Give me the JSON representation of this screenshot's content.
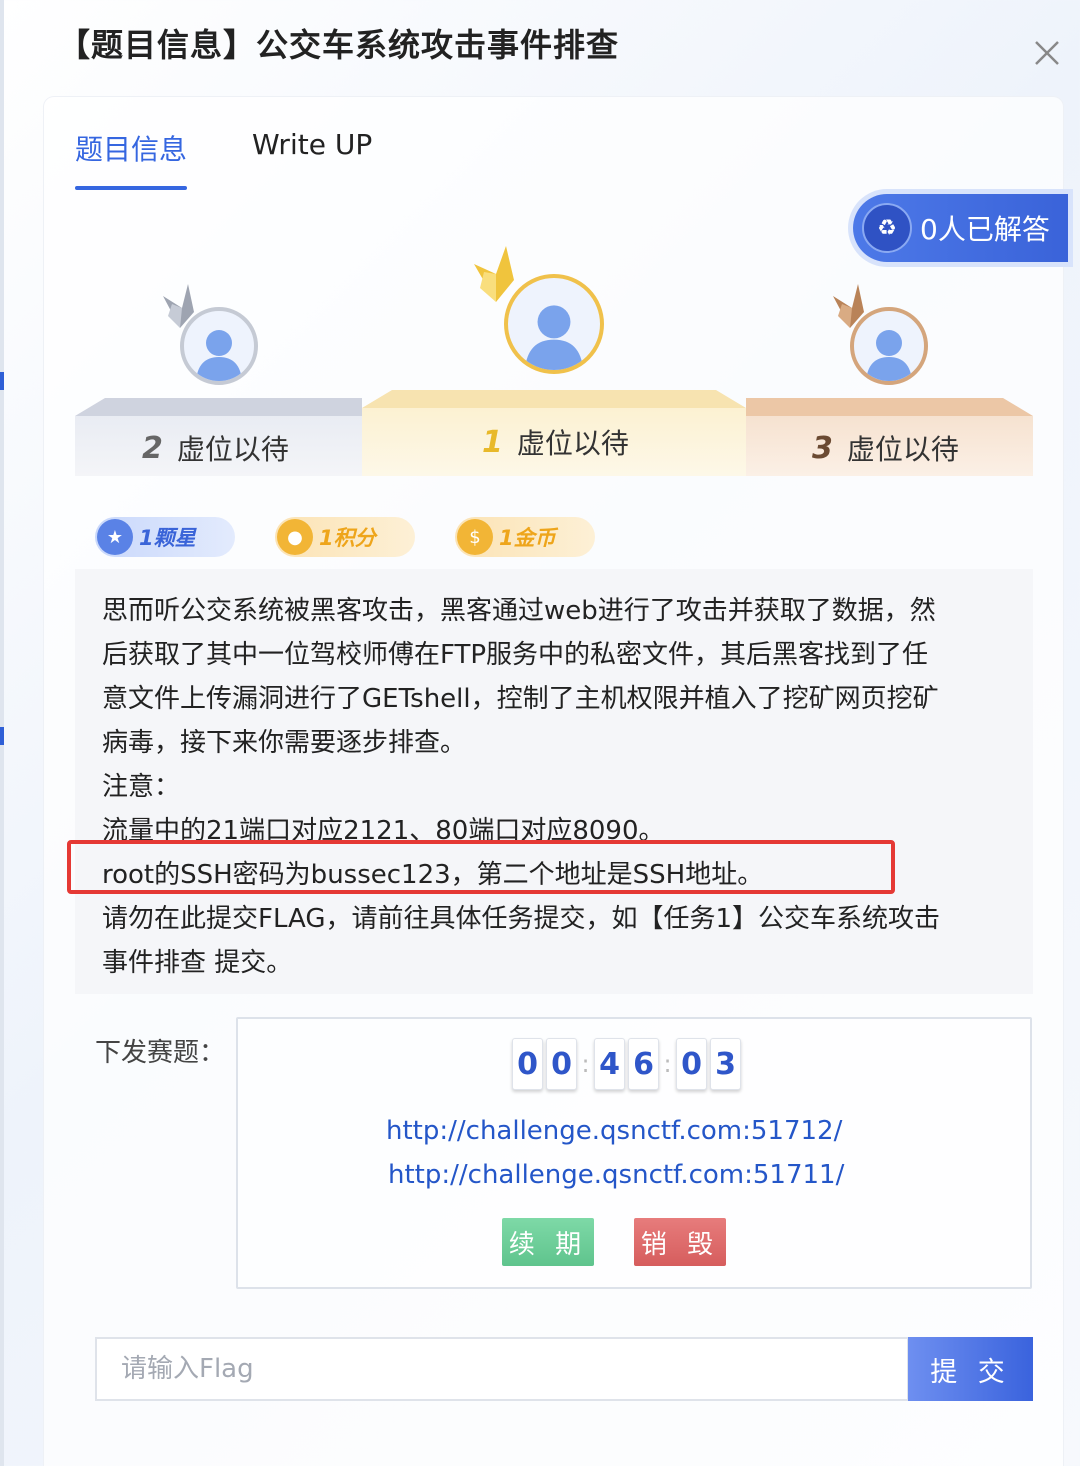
{
  "modal": {
    "title": "【题目信息】公交车系统攻击事件排查"
  },
  "tabs": [
    {
      "label": "题目信息",
      "active": true
    },
    {
      "label": "Write UP",
      "active": false
    }
  ],
  "solved": {
    "label": "0人已解答"
  },
  "podium": [
    {
      "rank": "2",
      "name": "虚位以待"
    },
    {
      "rank": "1",
      "name": "虚位以待"
    },
    {
      "rank": "3",
      "name": "虚位以待"
    }
  ],
  "rewards": [
    {
      "label": "1颗星",
      "icon": "star-icon"
    },
    {
      "label": "1积分",
      "icon": "points-icon"
    },
    {
      "label": "1金币",
      "icon": "coin-bag-icon"
    }
  ],
  "description": {
    "lines": [
      "思而听公交系统被黑客攻击，黑客通过web进行了攻击并获取了数据，然",
      "后获取了其中一位驾校师傅在FTP服务中的私密文件，其后黑客找到了任",
      "意文件上传漏洞进行了GETshell，控制了主机权限并植入了挖矿网页挖矿",
      "病毒，接下来你需要逐步排查。",
      "注意：",
      "流量中的21端口对应2121、80端口对应8090。",
      "root的SSH密码为bussec123，第二个地址是SSH地址。",
      "请勿在此提交FLAG，请前往具体任务提交，如【任务1】公交车系统攻击",
      "事件排查 提交。"
    ]
  },
  "dispatch": {
    "label": "下发赛题：",
    "timer": [
      "0",
      "0",
      "4",
      "6",
      "0",
      "3"
    ],
    "links": [
      "http://challenge.qsnctf.com:51712/",
      "http://challenge.qsnctf.com:51711/"
    ],
    "renew_label": "续 期",
    "destroy_label": "销 毁"
  },
  "flag": {
    "placeholder": "请输入Flag",
    "submit_label": "提 交"
  },
  "colors": {
    "accent": "#3566e0",
    "gold": "#f2c94c",
    "silver": "#b9bfcc",
    "bronze": "#d9a679",
    "highlight": "#e53935"
  }
}
